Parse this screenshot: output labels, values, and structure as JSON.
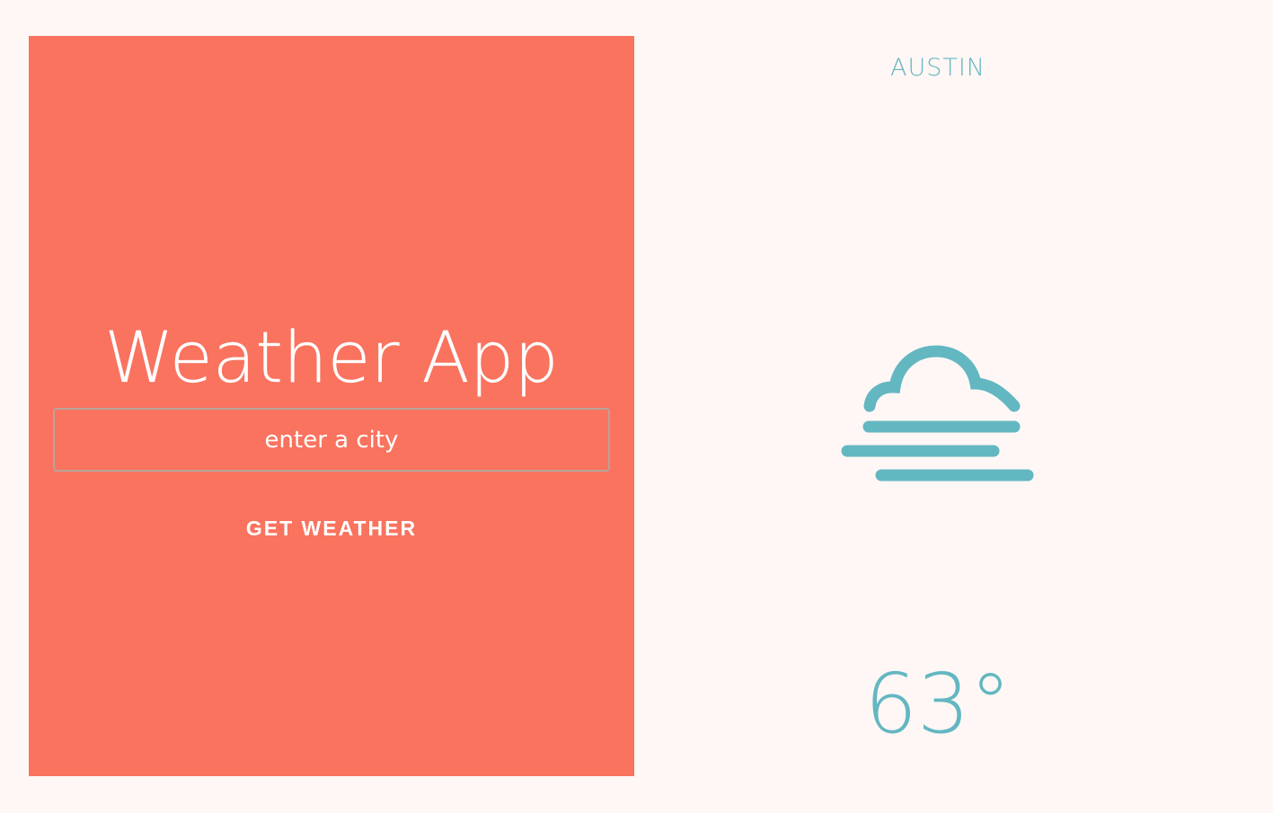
{
  "app": {
    "title": "Weather App"
  },
  "search": {
    "placeholder": "enter a city",
    "value": ""
  },
  "actions": {
    "get_weather_label": "GET WEATHER"
  },
  "result": {
    "city": "AUSTIN",
    "icon": "fog-icon",
    "temperature": "63°"
  },
  "colors": {
    "panel": "#f9735f",
    "background": "#fff7f5",
    "accent": "#63b7c1",
    "text_on_panel": "#ffffff"
  }
}
